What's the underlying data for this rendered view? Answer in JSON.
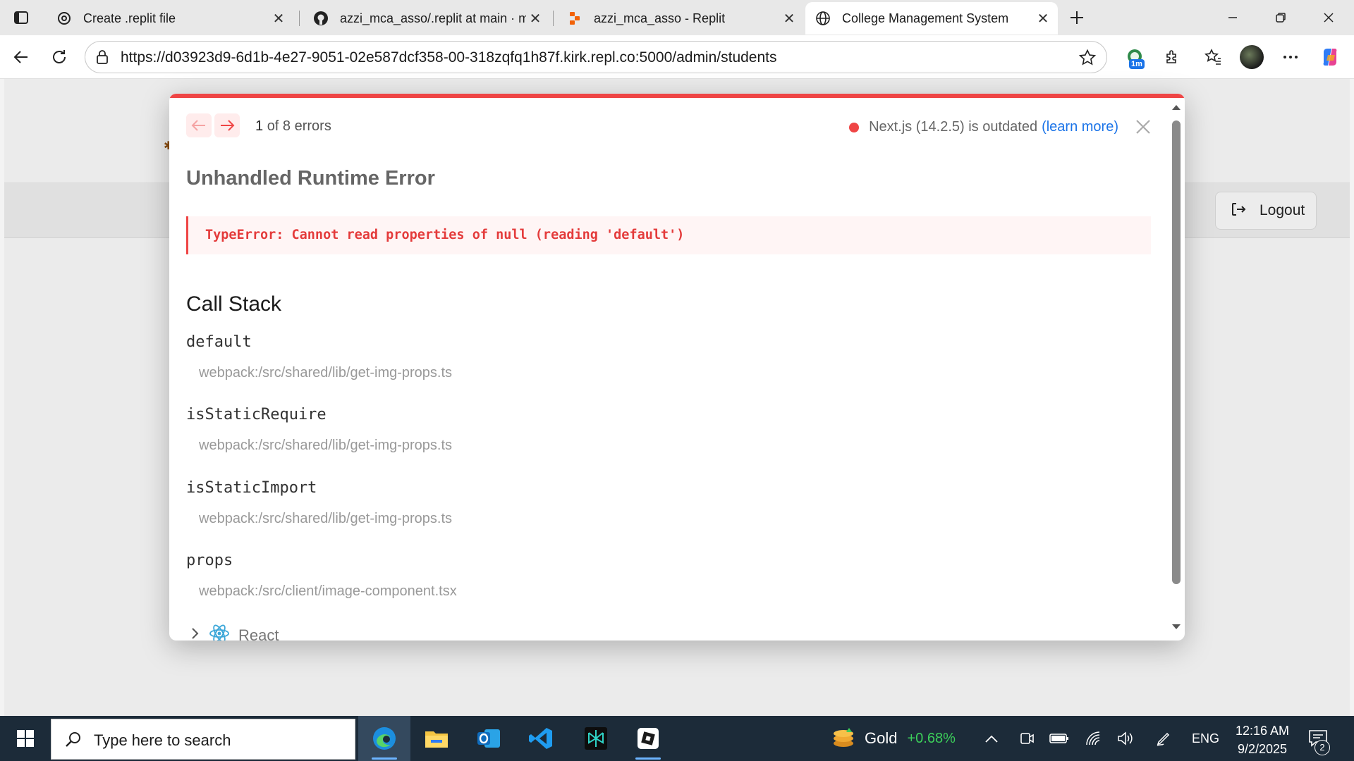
{
  "browser": {
    "tabs": [
      {
        "title": "Create .replit file",
        "icon": "chatgpt-icon",
        "active": false
      },
      {
        "title": "azzi_mca_asso/.replit at main · mo",
        "icon": "github-icon",
        "active": false
      },
      {
        "title": "azzi_mca_asso - Replit",
        "icon": "replit-icon",
        "active": false
      },
      {
        "title": "College Management System",
        "icon": "globe-icon",
        "active": true
      }
    ],
    "url": "https://d03923d9-6d1b-4e27-9051-02e587dcf358-00-318zqfq1h87f.kirk.repl.co:5000/admin/students",
    "extension_badge": "1m"
  },
  "page": {
    "logout_label": "Logout"
  },
  "error_overlay": {
    "error_index": "1",
    "error_total": "of 8 errors",
    "version_text": "Next.js (14.2.5) is outdated",
    "learn_more": "(learn more)",
    "title": "Unhandled Runtime Error",
    "message": "TypeError: Cannot read properties of null (reading 'default')",
    "call_stack_title": "Call Stack",
    "frames": [
      {
        "fn": "default",
        "file": "webpack:/src/shared/lib/get-img-props.ts"
      },
      {
        "fn": "isStaticRequire",
        "file": "webpack:/src/shared/lib/get-img-props.ts"
      },
      {
        "fn": "isStaticImport",
        "file": "webpack:/src/shared/lib/get-img-props.ts"
      },
      {
        "fn": "props",
        "file": "webpack:/src/client/image-component.tsx"
      }
    ],
    "collapsed_group": "React",
    "accent_color": "#ef4545"
  },
  "taskbar": {
    "search_placeholder": "Type here to search",
    "apps": [
      "edge-icon",
      "file-explorer-icon",
      "outlook-icon",
      "vscode-icon",
      "perplexity-icon",
      "roblox-studio-icon"
    ],
    "widget_name": "Gold",
    "widget_change": "+0.68%",
    "language": "ENG",
    "time": "12:16 AM",
    "date": "9/2/2025",
    "notification_count": "2"
  }
}
